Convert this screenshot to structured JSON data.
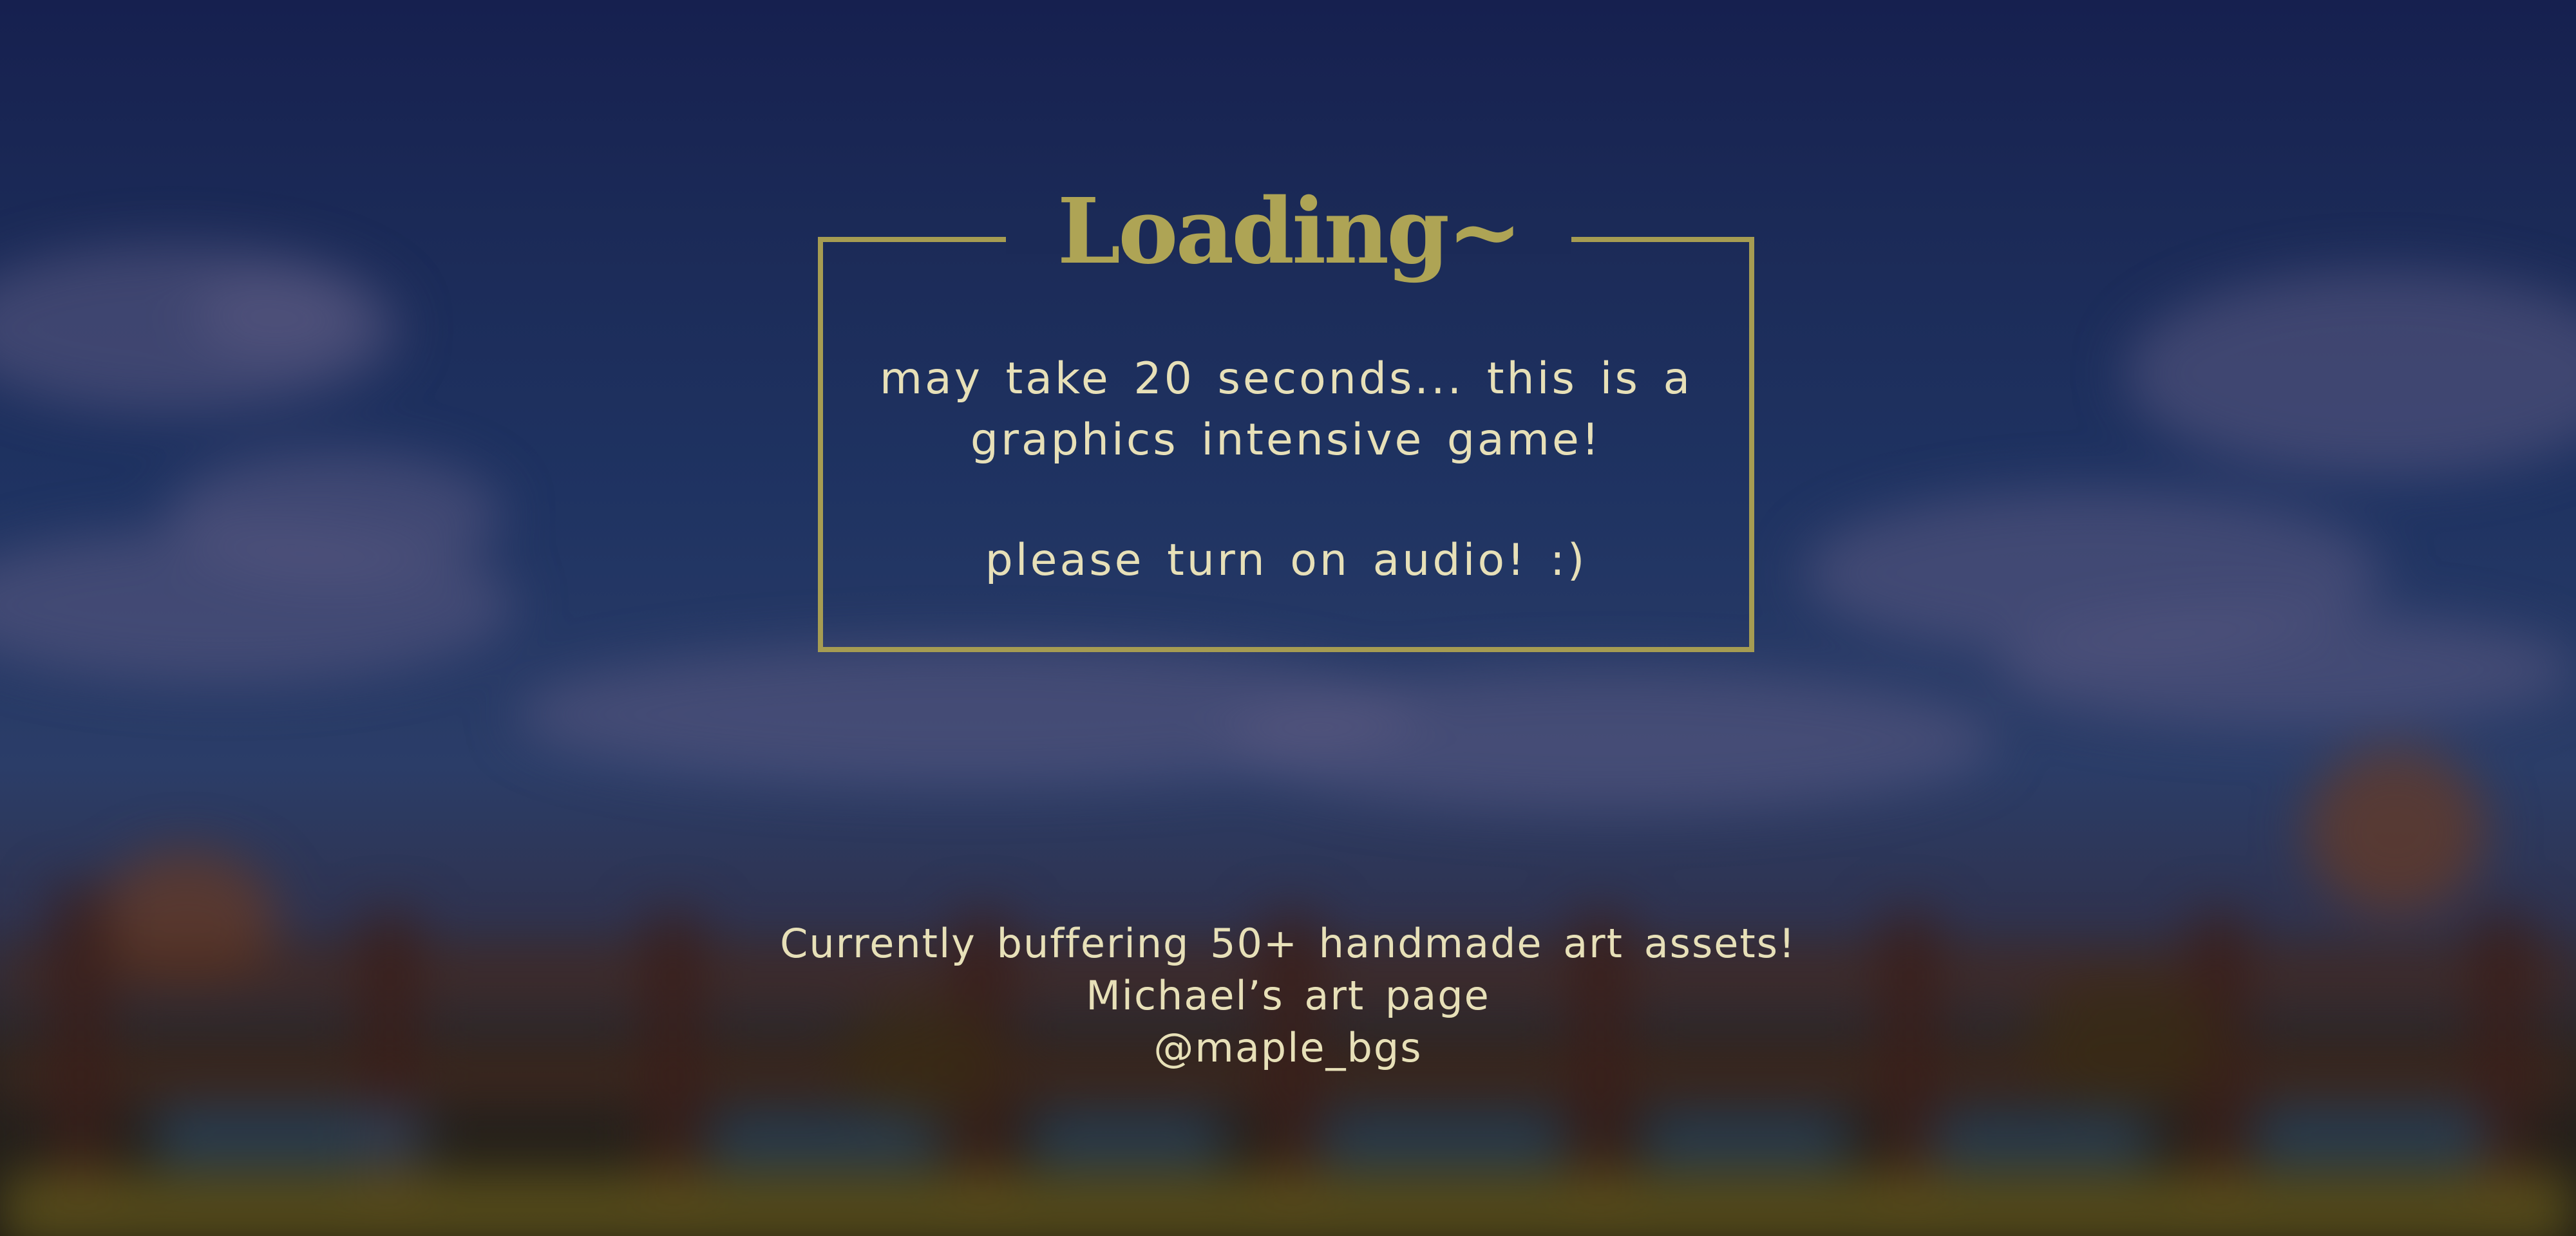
{
  "loading": {
    "title": "Loading~",
    "message_line1": "may take 20 seconds... this is a",
    "message_line2": "graphics intensive game!",
    "message_line3": "please turn on audio! :)"
  },
  "footer": {
    "buffering": "Currently buffering 50+ handmade art assets!",
    "art_page_link": "Michael’s art page",
    "handle_link": "@maple_bgs"
  },
  "colors": {
    "accent_gold": "#a69c52",
    "text_cream": "#e7e0b8",
    "sky_navy": "#1b2a57"
  }
}
